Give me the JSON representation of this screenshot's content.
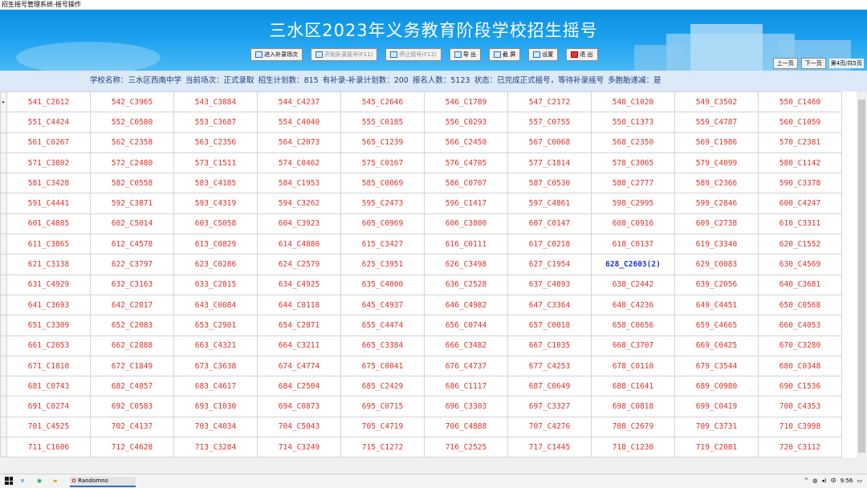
{
  "window": {
    "title": "招生摇号管理系统-摇号操作"
  },
  "header": {
    "title": "三水区2023年义务教育阶段学校招生摇号"
  },
  "toolbar": [
    {
      "label": "进入补录场次",
      "disabled": false,
      "icon": "enter-icon"
    },
    {
      "label": "开始补录摇号(F11)",
      "disabled": true,
      "icon": "start-icon"
    },
    {
      "label": "停止摇号(F12)",
      "disabled": true,
      "icon": "stop-icon"
    },
    {
      "label": "导 出",
      "disabled": false,
      "icon": "export-icon"
    },
    {
      "label": "截 屏",
      "disabled": false,
      "icon": "screenshot-icon"
    },
    {
      "label": "设置",
      "disabled": false,
      "icon": "settings-icon"
    },
    {
      "label": "退 出",
      "disabled": false,
      "icon": "exit-icon"
    }
  ],
  "nav": {
    "prev": "上一页",
    "next": "下一页",
    "page": "第4页/共5页"
  },
  "info": {
    "school": "学校名称：三水区西南中学",
    "session": "当前场次：正式录取",
    "plan": "招生计划数：815",
    "supplement": "有补录-补录计划数：200",
    "applicants": "报名人数：5123",
    "status": "状态：已完成正式摇号，等待补录摇号",
    "twins": "多胞胎递减：是"
  },
  "grid": {
    "highlight_color": "#1b2ff0",
    "normal_color": "#e0322b",
    "rows": [
      [
        "541_C2612",
        "542_C3965",
        "543_C3884",
        "544_C4237",
        "545_C2646",
        "546_C1789",
        "547_C2172",
        "548_C1020",
        "549_C3502",
        "550_C1460"
      ],
      [
        "551_C4424",
        "552_C0580",
        "553_C3687",
        "554_C4040",
        "555_C0185",
        "556_C0293",
        "557_C0755",
        "558_C1373",
        "559_C4787",
        "560_C1059"
      ],
      [
        "561_C0267",
        "562_C2358",
        "563_C2356",
        "564_C2073",
        "565_C1239",
        "566_C2450",
        "567_C0068",
        "568_C2350",
        "569_C1986",
        "570_C2381"
      ],
      [
        "571_C3802",
        "572_C2480",
        "573_C1511",
        "574_C0462",
        "575_C0167",
        "576_C4705",
        "577_C1814",
        "578_C3065",
        "579_C4099",
        "580_C1142"
      ],
      [
        "581_C3428",
        "582_C0558",
        "583_C4185",
        "584_C1953",
        "585_C0069",
        "586_C0707",
        "587_C0530",
        "588_C2777",
        "589_C2366",
        "590_C3378"
      ],
      [
        "591_C4441",
        "592_C3871",
        "593_C4319",
        "594_C3262",
        "595_C2473",
        "596_C1417",
        "597_C4861",
        "598_C2995",
        "599_C2846",
        "600_C4247"
      ],
      [
        "601_C4885",
        "602_C5014",
        "603_C5058",
        "604_C3923",
        "605_C0969",
        "606_C3800",
        "607_C0147",
        "608_C0916",
        "609_C2738",
        "610_C3311"
      ],
      [
        "611_C3865",
        "612_C4578",
        "613_C0829",
        "614_C4880",
        "615_C3427",
        "616_C0111",
        "617_C0218",
        "618_C0137",
        "619_C3340",
        "620_C1552"
      ],
      [
        "621_C3138",
        "622_C3797",
        "623_C0286",
        "624_C2579",
        "625_C3951",
        "626_C3498",
        "627_C1954",
        "628_C2603(2)",
        "629_C0083",
        "630_C4569"
      ],
      [
        "631_C4929",
        "632_C3163",
        "633_C2815",
        "634_C4925",
        "635_C4000",
        "636_C2528",
        "637_C4893",
        "638_C2442",
        "639_C2056",
        "640_C3681"
      ],
      [
        "641_C3693",
        "642_C2817",
        "643_C0084",
        "644_C0118",
        "645_C4937",
        "646_C4982",
        "647_C3364",
        "648_C4236",
        "649_C4451",
        "650_C0568"
      ],
      [
        "651_C3309",
        "652_C2083",
        "653_C2901",
        "654_C2871",
        "655_C4474",
        "656_C0744",
        "657_C0018",
        "658_C0656",
        "659_C4665",
        "660_C4053"
      ],
      [
        "661_C2053",
        "662_C2888",
        "663_C4321",
        "664_C3211",
        "665_C3384",
        "666_C3482",
        "667_C1035",
        "668_C3707",
        "669_C0425",
        "670_C3280"
      ],
      [
        "671_C1810",
        "672_C1849",
        "673_C3638",
        "674_C4774",
        "675_C0041",
        "676_C4737",
        "677_C4253",
        "678_C0110",
        "679_C3544",
        "680_C0348"
      ],
      [
        "681_C0743",
        "682_C4857",
        "683_C4617",
        "684_C2504",
        "685_C2429",
        "686_C1117",
        "687_C0649",
        "688_C1641",
        "689_C0980",
        "690_C1536"
      ],
      [
        "691_C0274",
        "692_C0583",
        "693_C1030",
        "694_C0873",
        "695_C0715",
        "696_C3303",
        "697_C3327",
        "698_C0818",
        "699_C0419",
        "700_C4353"
      ],
      [
        "701_C4525",
        "702_C4137",
        "703_C4034",
        "704_C5043",
        "705_C4719",
        "706_C4888",
        "707_C4276",
        "708_C2679",
        "709_C3731",
        "710_C3998"
      ],
      [
        "711_C1606",
        "712_C4628",
        "713_C3284",
        "714_C3249",
        "715_C1272",
        "716_C2525",
        "717_C1445",
        "718_C1230",
        "719_C2081",
        "720_C3112"
      ]
    ],
    "highlight": {
      "row": 8,
      "col": 7
    }
  },
  "taskbar": {
    "app_label": "Randomno",
    "ime": "中",
    "time": "9:56"
  }
}
